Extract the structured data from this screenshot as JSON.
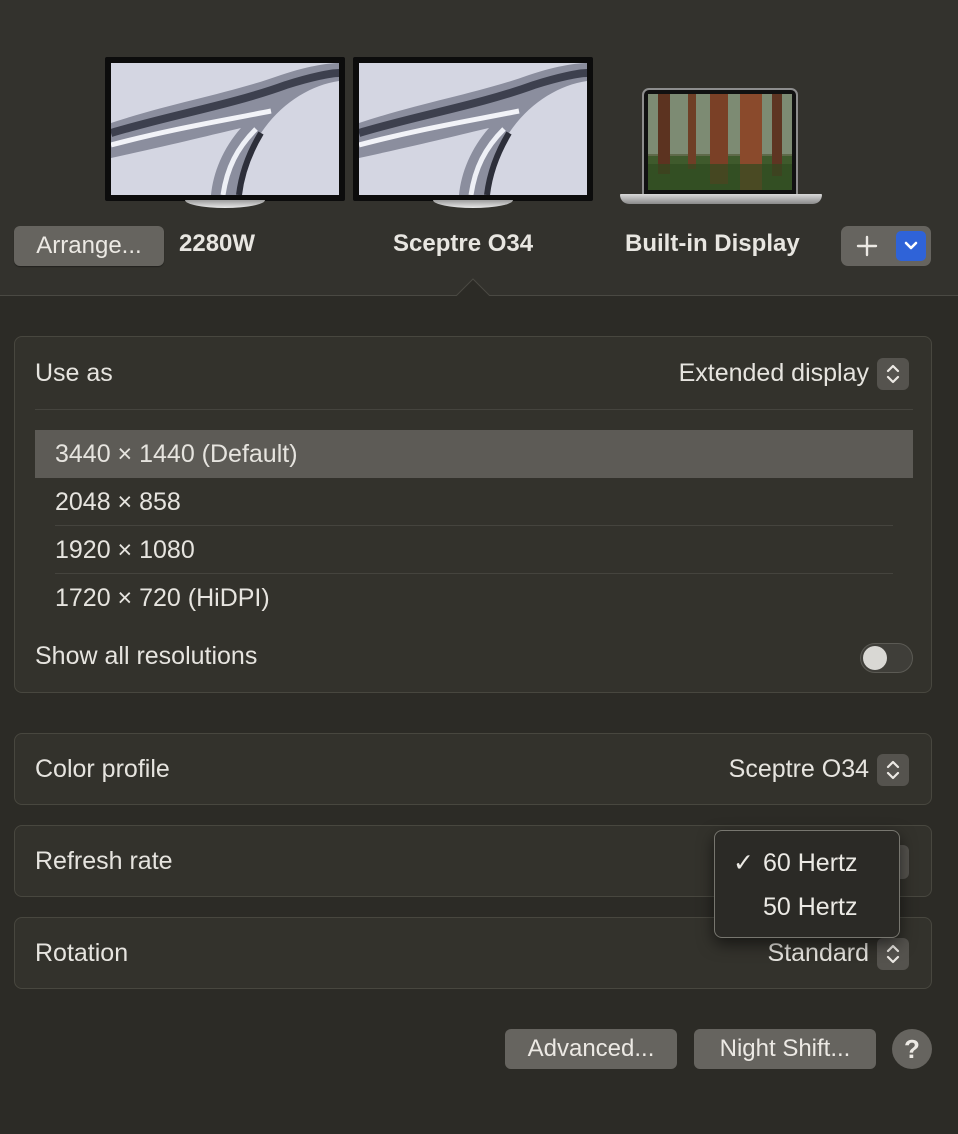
{
  "displays": [
    {
      "name": "2280W"
    },
    {
      "name": "Sceptre O34"
    },
    {
      "name": "Built-in Display"
    }
  ],
  "toolbar": {
    "arrange_label": "Arrange...",
    "add_label": "+"
  },
  "use_as": {
    "label": "Use as",
    "value": "Extended display"
  },
  "resolutions": {
    "items": [
      "3440 × 1440 (Default)",
      "2048 × 858",
      "1920 × 1080",
      "1720 × 720 (HiDPI)"
    ],
    "selected": 0,
    "show_all_label": "Show all resolutions",
    "show_all_on": false
  },
  "color_profile": {
    "label": "Color profile",
    "value": "Sceptre O34"
  },
  "refresh_rate": {
    "label": "Refresh rate",
    "menu": [
      {
        "label": "60 Hertz",
        "checked": true,
        "check": "✓"
      },
      {
        "label": "50 Hertz",
        "checked": false,
        "check": ""
      }
    ]
  },
  "rotation": {
    "label": "Rotation",
    "value": "Standard"
  },
  "buttons": {
    "advanced": "Advanced...",
    "night_shift": "Night Shift...",
    "help": "?"
  },
  "colors": {
    "background": "#2c2b26",
    "accent": "#2f63d8",
    "button": "#66645f"
  }
}
